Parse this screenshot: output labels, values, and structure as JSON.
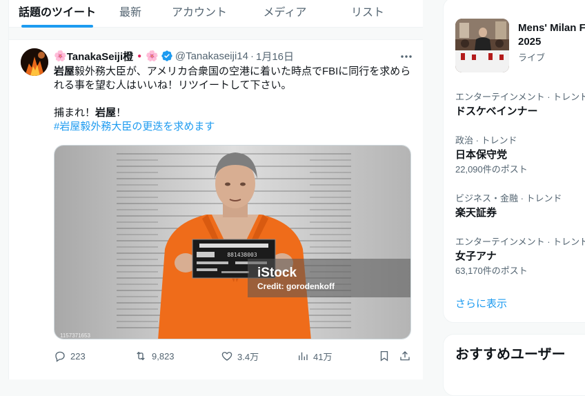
{
  "tabs": [
    {
      "label": "話題のツイート",
      "active": true
    },
    {
      "label": "最新",
      "active": false
    },
    {
      "label": "アカウント",
      "active": false
    },
    {
      "label": "メディア",
      "active": false
    },
    {
      "label": "リスト",
      "active": false
    }
  ],
  "tweet": {
    "name_prefix_emoji": "🌸",
    "name": "TanakaSeiji橙",
    "name_suffix_emoji": "🌸",
    "flag": "●",
    "handle": "@Tanakaseiji14",
    "separator": "·",
    "date": "1月16日",
    "text_line1_bold": "岩屋",
    "text_line1_rest": "毅外務大臣が、アメリカ合衆国の空港に着いた時点でFBIに同行を求めら",
    "text_line2": "れる事を望む人はいいね！リツイートして下さい。",
    "text_line3_pre": "捕まれ！",
    "text_line3_bold": "岩屋",
    "text_line3_post": "！",
    "hashtag": "#岩屋毅外務大臣の更迭を求めます",
    "media": {
      "watermark": "iStock",
      "credit": "Credit: gorodenkoff",
      "id_text": "1157371653",
      "board_number": "881438003"
    },
    "stats": {
      "replies": "223",
      "retweets": "9,823",
      "likes": "3.4万",
      "views": "41万"
    }
  },
  "sidebar": {
    "news_title_line1": "Mens' Milan F",
    "news_title_line2": "2025",
    "news_category": "ライブ",
    "trends": [
      {
        "category": "エンターテインメント · トレンド",
        "topic": "ドスケベインナー",
        "count": ""
      },
      {
        "category": "政治 · トレンド",
        "topic": "日本保守党",
        "count": "22,090件のポスト"
      },
      {
        "category": "ビジネス・金融 · トレンド",
        "topic": "楽天証券",
        "count": ""
      },
      {
        "category": "エンターテインメント · トレンド",
        "topic": "女子アナ",
        "count": "63,170件のポスト"
      }
    ],
    "show_more": "さらに表示",
    "recommended_title": "おすすめユーザー"
  },
  "colors": {
    "accent": "#1d9bf0",
    "secondary_text": "#536471",
    "jumpsuit": "#ef6c1a"
  }
}
